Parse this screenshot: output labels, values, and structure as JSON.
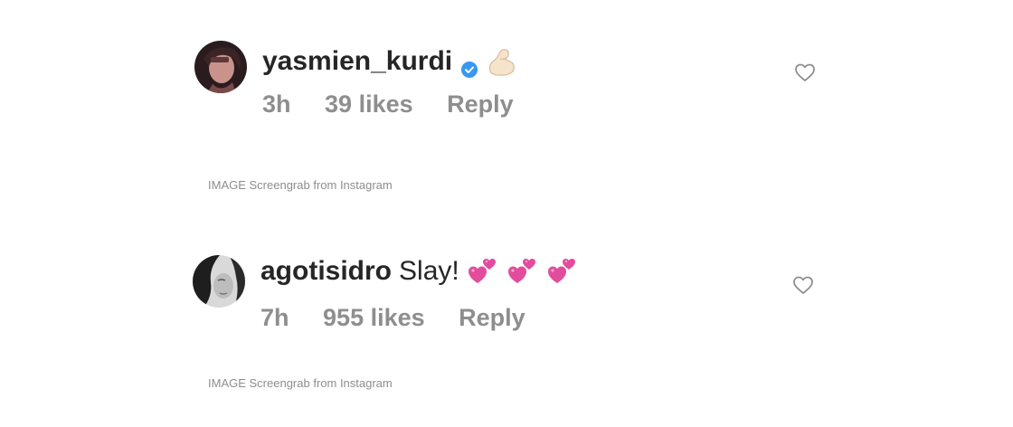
{
  "comments": [
    {
      "username": "yasmien_kurdi",
      "verified": true,
      "text": "",
      "emoji": "flexed-biceps",
      "time": "3h",
      "likes": "39 likes",
      "reply": "Reply",
      "caption": "IMAGE Screengrab from Instagram"
    },
    {
      "username": "agotisidro",
      "verified": false,
      "text": "Slay!",
      "emoji": "two-hearts x3",
      "time": "7h",
      "likes": "955 likes",
      "reply": "Reply",
      "caption": "IMAGE Screengrab from Instagram"
    }
  ],
  "colors": {
    "text": "#262626",
    "secondary": "#8e8e8e",
    "verified": "#3897f0",
    "heart_emoji": "#e24c9c"
  }
}
